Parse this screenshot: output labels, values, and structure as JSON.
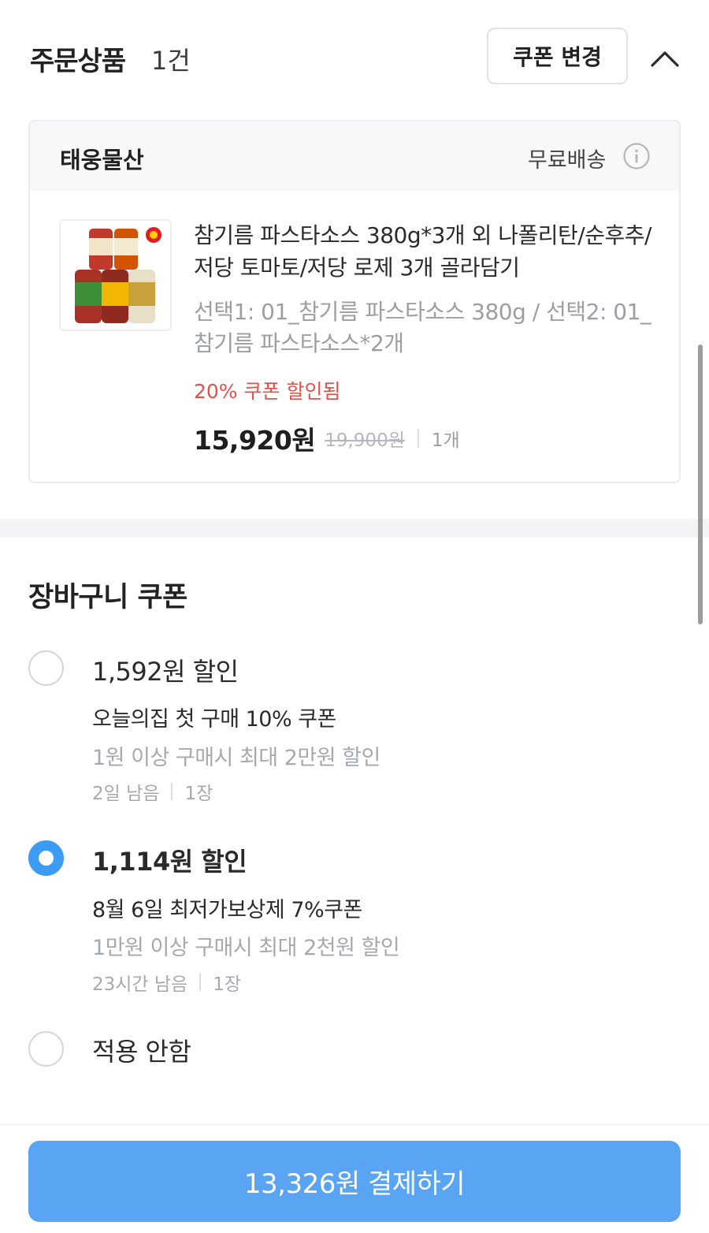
{
  "order": {
    "title": "주문상품",
    "count": "1건",
    "coupon_change_label": "쿠폰 변경"
  },
  "seller": {
    "name": "태웅물산",
    "shipping": "무료배송"
  },
  "product": {
    "name": "참기름 파스타소스 380g*3개 외 나폴리탄/순후추/저당 토마토/저당 로제 3개 골라담기",
    "option": "선택1: 01_참기름 파스타소스 380g / 선택2: 01_참기름 파스타소스*2개",
    "discount_note": "20% 쿠폰 할인됨",
    "price": "15,920원",
    "original_price": "19,900원",
    "quantity": "1개"
  },
  "cart_coupon": {
    "title": "장바구니 쿠폰",
    "options": [
      {
        "amount": "1,592원 할인",
        "name": "오늘의집 첫 구매 10% 쿠폰",
        "condition": "1원 이상 구매시 최대 2만원 할인",
        "remaining": "2일 남음",
        "count": "1장",
        "selected": false
      },
      {
        "amount": "1,114원 할인",
        "name": "8월 6일 최저가보상제 7%쿠폰",
        "condition": "1만원 이상 구매시 최대 2천원 할인",
        "remaining": "23시간 남음",
        "count": "1장",
        "selected": true
      },
      {
        "amount": "적용 안함",
        "selected": false
      }
    ]
  },
  "payment": {
    "button_label": "13,326원 결제하기"
  },
  "colors": {
    "accent": "#3c9bf3",
    "pay_button": "#5aa5f3",
    "discount_red": "#e2514a"
  }
}
